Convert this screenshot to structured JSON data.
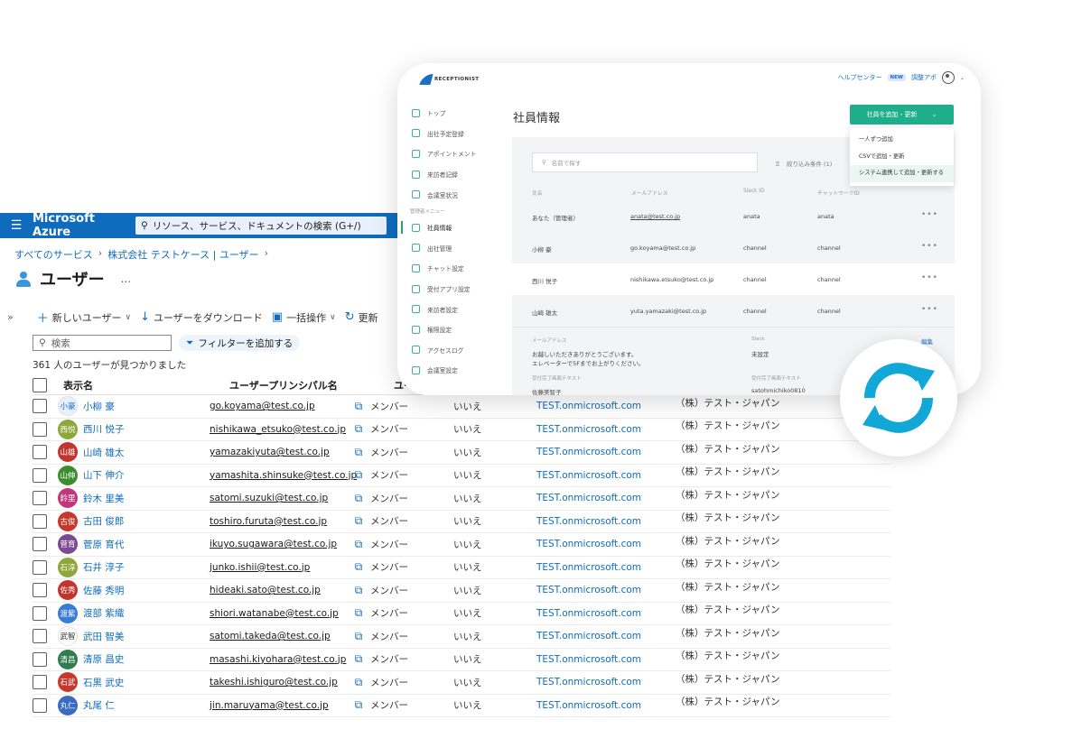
{
  "azure": {
    "brand": "Microsoft Azure",
    "search_placeholder": "リソース、サービス、ドキュメントの検索 (G+/)",
    "breadcrumb": [
      "すべてのサービス",
      "株式会社 テストケース  | ユーザー"
    ],
    "page_title": "ユーザー",
    "title_more": "...",
    "toolbar": {
      "new_user": "新しいユーザー",
      "download": "ユーザーをダウンロード",
      "bulk": "一括操作",
      "refresh": "更新"
    },
    "filter_search_placeholder": "検索",
    "add_filter": "フィルターを追加する",
    "count_text": "361 人のユーザーが見つかりました",
    "columns": {
      "display_name": "表示名",
      "upn": "ユーザープリンシパル名",
      "user_type": "ユーザ"
    },
    "rows": [
      {
        "initials": "小豪",
        "color": "#e8f1fb",
        "textcolor": "#0f6cbd",
        "name": "小柳 豪",
        "upn": "go.koyama@test.co.jp",
        "type": "メンバー",
        "yn": "いいえ",
        "domain": "TEST.onmicrosoft.com",
        "company": "（株）テスト・ジャパン"
      },
      {
        "initials": "西悦",
        "color": "#8fa63a",
        "textcolor": "#ffffff",
        "name": "西川 悦子",
        "upn": "nishikawa_etsuko@test.co.jp",
        "type": "メンバー",
        "yn": "いいえ",
        "domain": "TEST.onmicrosoft.com",
        "company": "（株）テスト・ジャパン"
      },
      {
        "initials": "山雄",
        "color": "#c2352f",
        "textcolor": "#ffffff",
        "name": "山崎 雄太",
        "upn": "yamazakiyuta@test.co.jp",
        "type": "メンバー",
        "yn": "いいえ",
        "domain": "TEST.onmicrosoft.com",
        "company": "（株）テスト・ジャパン"
      },
      {
        "initials": "山伸",
        "color": "#3c8d2f",
        "textcolor": "#ffffff",
        "name": "山下 伸介",
        "upn": "yamashita.shinsuke@test.co.jp",
        "type": "メンバー",
        "yn": "いいえ",
        "domain": "TEST.onmicrosoft.com",
        "company": "（株）テスト・ジャパン"
      },
      {
        "initials": "鈴里",
        "color": "#c2367b",
        "textcolor": "#ffffff",
        "name": "鈴木 里美",
        "upn": "satomi.suzuki@test.co.jp",
        "type": "メンバー",
        "yn": "いいえ",
        "domain": "TEST.onmicrosoft.com",
        "company": "（株）テスト・ジャパン"
      },
      {
        "initials": "古俊",
        "color": "#c8372c",
        "textcolor": "#ffffff",
        "name": "古田 俊郎",
        "upn": "toshiro.furuta@test.co.jp",
        "type": "メンバー",
        "yn": "いいえ",
        "domain": "TEST.onmicrosoft.com",
        "company": "（株）テスト・ジャパン"
      },
      {
        "initials": "菅育",
        "color": "#7b4a8f",
        "textcolor": "#ffffff",
        "name": "菅原 育代",
        "upn": "ikuyo.sugawara@test.co.jp",
        "type": "メンバー",
        "yn": "いいえ",
        "domain": "TEST.onmicrosoft.com",
        "company": "（株）テスト・ジャパン"
      },
      {
        "initials": "石淳",
        "color": "#8fa63a",
        "textcolor": "#ffffff",
        "name": "石井 淳子",
        "upn": "junko.ishii@test.co.jp",
        "type": "メンバー",
        "yn": "いいえ",
        "domain": "TEST.onmicrosoft.com",
        "company": "（株）テスト・ジャパン"
      },
      {
        "initials": "佐秀",
        "color": "#c2352f",
        "textcolor": "#ffffff",
        "name": "佐藤 秀明",
        "upn": "hideaki.sato@test.co.jp",
        "type": "メンバー",
        "yn": "いいえ",
        "domain": "TEST.onmicrosoft.com",
        "company": "（株）テスト・ジャパン"
      },
      {
        "initials": "渡紫",
        "color": "#3a7bd5",
        "textcolor": "#ffffff",
        "name": "渡部 紫織",
        "upn": "shiori.watanabe@test.co.jp",
        "type": "メンバー",
        "yn": "いいえ",
        "domain": "TEST.onmicrosoft.com",
        "company": "（株）テスト・ジャパン"
      },
      {
        "initials": "武智",
        "color": "#ffffff",
        "textcolor": "#323130",
        "name": "武田 智美",
        "upn": "satomi.takeda@test.co.jp",
        "type": "メンバー",
        "yn": "いいえ",
        "domain": "TEST.onmicrosoft.com",
        "company": "（株）テスト・ジャパン"
      },
      {
        "initials": "清昌",
        "color": "#2f7d4f",
        "textcolor": "#ffffff",
        "name": "清原 昌史",
        "upn": "masashi.kiyohara@test.co.jp",
        "type": "メンバー",
        "yn": "いいえ",
        "domain": "TEST.onmicrosoft.com",
        "company": "（株）テスト・ジャパン"
      },
      {
        "initials": "石武",
        "color": "#c8372c",
        "textcolor": "#ffffff",
        "name": "石黒 武史",
        "upn": "takeshi.ishiguro@test.co.jp",
        "type": "メンバー",
        "yn": "いいえ",
        "domain": "TEST.onmicrosoft.com",
        "company": "（株）テスト・ジャパン"
      },
      {
        "initials": "丸仁",
        "color": "#3a6bc4",
        "textcolor": "#ffffff",
        "name": "丸尾 仁",
        "upn": "jin.maruyama@test.co.jp",
        "type": "メンバー",
        "yn": "いいえ",
        "domain": "TEST.onmicrosoft.com",
        "company": "（株）テスト・ジャパン"
      }
    ]
  },
  "receptionist": {
    "logo": "RECEPTIONIST",
    "help": "ヘルプセンター",
    "new_badge": "NEW",
    "adjust": "調整アポ",
    "nav": [
      "トップ",
      "出社予定登録",
      "アポイントメント",
      "来訪者記録",
      "会議室状況"
    ],
    "admin_section": "管理者メニュー",
    "admin_nav": [
      "社員情報",
      "出社管理",
      "チャット設定",
      "受付アプリ設定",
      "来訪者設定",
      "権限設定",
      "アクセスログ",
      "会議室設定"
    ],
    "page_title": "社員情報",
    "add_button": "社員を追加・更新",
    "dropdown": [
      "一人ずつ追加",
      "CSVで追加・更新",
      "システム連携して追加・更新する"
    ],
    "search_placeholder": "名前で探す",
    "filter_label": "絞り込み条件 (1)",
    "columns": [
      "氏名",
      "メールアドレス",
      "Slack ID",
      "チャットワークID"
    ],
    "rows": [
      {
        "name": "あなた（管理者）",
        "email": "anata@test.co.jp",
        "slack": "anata",
        "chat": "anata"
      },
      {
        "name": "小柳 豪",
        "email": "go.koyama@test.co.jp",
        "slack": "channel",
        "chat": "channel"
      },
      {
        "name": "西川 悦子",
        "email": "nishikawa.etsuko@test.co.jp",
        "slack": "channel",
        "chat": "channel"
      },
      {
        "name": "山崎 雄太",
        "email": "yuta.yamazaki@test.co.jp",
        "slack": "channel",
        "chat": "channel"
      }
    ],
    "detail": {
      "email_label": "メールアドレス",
      "message_line1": "お越しいただきありがとうございます。",
      "message_line2": "エレベーターで5Fまでお上がりください。",
      "sent_label": "受付完了画面テキスト",
      "sent_value": "佐藤美智子",
      "slack_label": "Slack",
      "slack_value": "未設定",
      "text_label": "受付完了画面テキスト",
      "text_value": "satohmichiko0810",
      "edit": "編集"
    },
    "dots": "•••"
  },
  "colors": {
    "azure_blue": "#0f6cbd",
    "receptionist_green": "#1fae8a",
    "sync_cyan": "#11a7d6"
  },
  "icons": [
    "hamburger-icon",
    "search-icon",
    "user-icon",
    "plus-icon",
    "download-icon",
    "bulk-icon",
    "refresh-icon",
    "filter-icon",
    "copy-icon",
    "sync-icon",
    "chevron-down-icon"
  ]
}
